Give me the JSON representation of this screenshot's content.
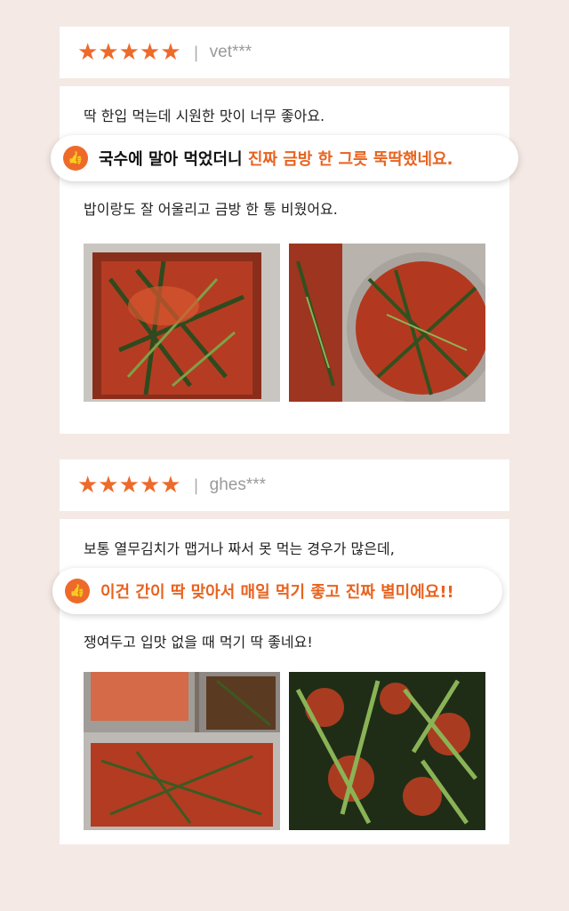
{
  "reviews": [
    {
      "stars": "★★★★★",
      "separator": "|",
      "user": "vet***",
      "line1": "딱 한입 먹는데 시원한 맛이 너무 좋아요.",
      "highlight_plain": "국수에 말아 먹었더니 ",
      "highlight_accent": "진짜 금방 한 그릇 뚝딱했네요.",
      "line2": "밥이랑도 잘 어울리고 금방 한 통 비웠어요."
    },
    {
      "stars": "★★★★★",
      "separator": "|",
      "user": "ghes***",
      "line1": "보통 열무김치가 맵거나 짜서 못 먹는 경우가 많은데,",
      "highlight_plain": "",
      "highlight_accent": "이건 간이 딱 맞아서 매일 먹기 좋고 진짜 별미에요!!",
      "line2": "쟁여두고 입맛 없을 때 먹기 딱 좋네요!"
    }
  ],
  "colors": {
    "accent": "#ee6a2a",
    "background": "#f5e9e5"
  },
  "icons": {
    "badge": "thumbs-up-icon"
  }
}
